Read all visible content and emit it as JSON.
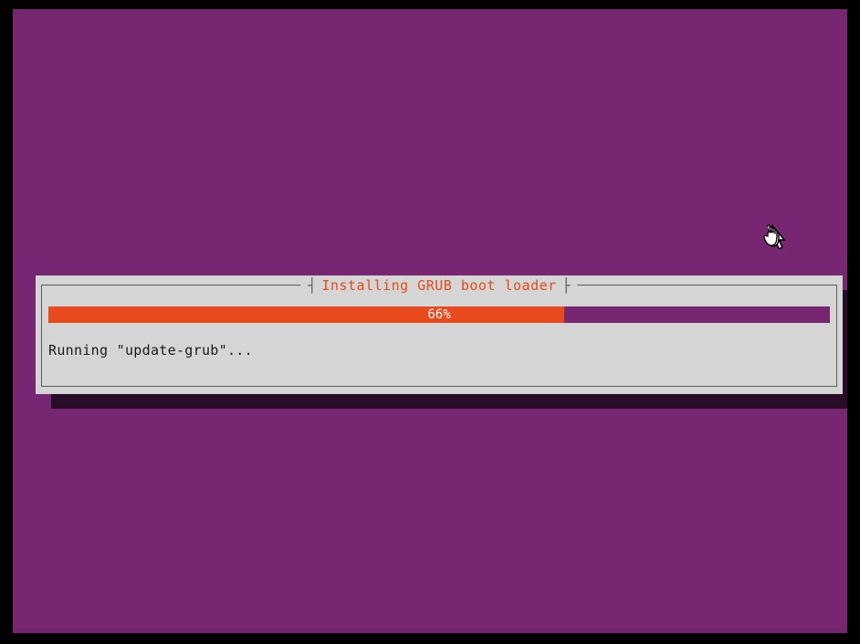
{
  "dialog": {
    "title": "Installing GRUB boot loader",
    "status_text": "Running \"update-grub\"..."
  },
  "progress": {
    "percent": 66,
    "label": "66%"
  },
  "colors": {
    "background": "#772772",
    "accent": "#e84a1e",
    "panel": "#d5d5d5"
  }
}
